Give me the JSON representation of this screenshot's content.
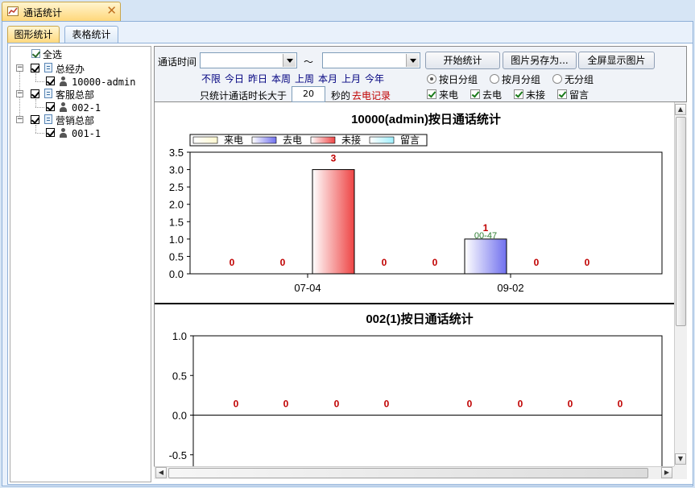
{
  "window": {
    "tab_title": "通话统计",
    "close": "✕"
  },
  "tabs": [
    {
      "label": "图形统计"
    },
    {
      "label": "表格统计"
    }
  ],
  "tree": {
    "select_all": "全选",
    "groups": [
      {
        "label": "总经办",
        "members": [
          "10000-admin"
        ]
      },
      {
        "label": "客服总部",
        "members": [
          "002-1"
        ]
      },
      {
        "label": "营销总部",
        "members": [
          "001-1"
        ]
      }
    ]
  },
  "toolbar": {
    "time_label": "通话时间",
    "tilde": "～",
    "start_button": "开始统计",
    "save_button": "图片另存为...",
    "fullscreen_button": "全屏显示图片",
    "quick_ranges": [
      "不限",
      "今日",
      "昨日",
      "本周",
      "上周",
      "本月",
      "上月",
      "今年"
    ],
    "duration_prefix": "只统计通话时长大于",
    "duration_value": "20",
    "duration_suffix": "秒的",
    "duration_highlight": "去电记录",
    "grouping": [
      "按日分组",
      "按月分组",
      "无分组"
    ],
    "grouping_selected": "按日分组",
    "filters": [
      "来电",
      "去电",
      "未接",
      "留言"
    ]
  },
  "colors": {
    "incoming": "#fff8d0",
    "outgoing": "#7070ee",
    "missed": "#ee4444",
    "voicemail": "#a0f0ff",
    "value_label": "#c00000"
  },
  "chart_data": [
    {
      "type": "bar",
      "title": "10000(admin)按日通话统计",
      "legend": [
        "来电",
        "去电",
        "未接",
        "留言"
      ],
      "categories": [
        "07-04",
        "09-02"
      ],
      "series": [
        {
          "name": "来电",
          "values": [
            0,
            0
          ]
        },
        {
          "name": "去电",
          "values": [
            0,
            1
          ]
        },
        {
          "name": "未接",
          "values": [
            3,
            0
          ]
        },
        {
          "name": "留言",
          "values": [
            0,
            0
          ]
        }
      ],
      "annotation": "00-47",
      "ylim": [
        0,
        3.5
      ],
      "yticks": [
        "3.5",
        "3.0",
        "2.5",
        "2.0",
        "1.5",
        "1.0",
        "0.5",
        "0.0"
      ]
    },
    {
      "type": "bar",
      "title": "002(1)按日通话统计",
      "categories": [],
      "values": [
        0,
        0,
        0,
        0,
        0,
        0,
        0,
        0
      ],
      "ylim": [
        -1,
        1
      ],
      "yticks": [
        "1.0",
        "0.5",
        "0.0",
        "-0.5"
      ]
    }
  ]
}
